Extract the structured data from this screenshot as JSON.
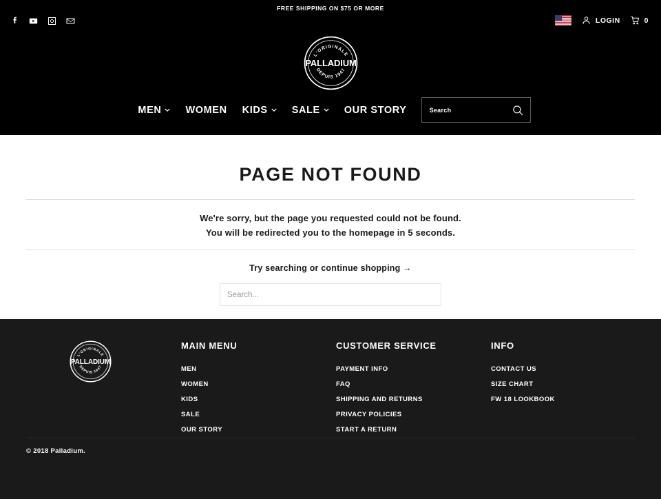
{
  "announcement": {
    "text": "FREE SHIPPING ON $75 OR MORE"
  },
  "header": {
    "social": [
      {
        "name": "facebook-icon",
        "label": "Facebook"
      },
      {
        "name": "youtube-icon",
        "label": "YouTube"
      },
      {
        "name": "instagram-icon",
        "label": "Instagram"
      },
      {
        "name": "email-icon",
        "label": "Email"
      }
    ],
    "country_flag": "us-flag-icon",
    "login_label": "LOGIN",
    "cart_count": "0",
    "logo": {
      "top_arc": "L'ORIGINALE",
      "center": "PALLADIUM",
      "bottom_arc": "DEPUIS 1947"
    }
  },
  "nav": {
    "items": [
      {
        "label": "MEN",
        "has_dropdown": true
      },
      {
        "label": "WOMEN",
        "has_dropdown": false
      },
      {
        "label": "KIDS",
        "has_dropdown": true
      },
      {
        "label": "SALE",
        "has_dropdown": true
      },
      {
        "label": "OUR STORY",
        "has_dropdown": false
      }
    ],
    "search": {
      "placeholder": "Search",
      "value": ""
    }
  },
  "main": {
    "title": "PAGE NOT FOUND",
    "message_line_1": "We're sorry, but the page you requested could not be found.",
    "message_line_2": "You will be redirected you to the homepage in 5 seconds.",
    "shop_link": "Try searching or continue shopping →",
    "search": {
      "placeholder": "Search...",
      "value": ""
    }
  },
  "footer": {
    "columns": [
      {
        "heading": "MAIN MENU",
        "links": [
          "MEN",
          "WOMEN",
          "KIDS",
          "SALE",
          "OUR STORY"
        ]
      },
      {
        "heading": "CUSTOMER SERVICE",
        "links": [
          "PAYMENT INFO",
          "FAQ",
          "SHIPPING AND RETURNS",
          "PRIVACY POLICIES",
          "START A RETURN"
        ]
      },
      {
        "heading": "INFO",
        "links": [
          "CONTACT US",
          "SIZE CHART",
          "FW 18 LOOKBOOK"
        ]
      }
    ],
    "copyright": "© 2018 Palladium.",
    "logo": {
      "top_arc": "L'ORIGINALE",
      "center": "PALLADIUM",
      "bottom_arc": "DEPUIS 1947"
    }
  },
  "colors": {
    "header_bg": "#000000",
    "footer_bg": "#1a1a1a",
    "text_dark": "#1a1a1a",
    "rule": "#dedede"
  }
}
